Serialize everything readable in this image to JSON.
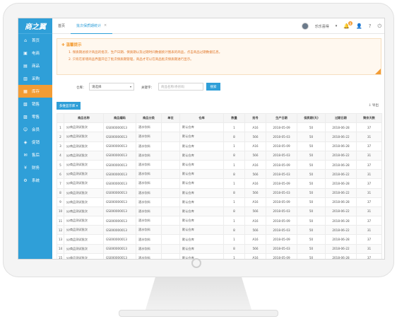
{
  "app": {
    "logo_text": "商之翼"
  },
  "sidebar": {
    "items": [
      {
        "label": "首页",
        "icon": "home-icon",
        "glyph": "⌂",
        "active": false
      },
      {
        "label": "电商",
        "icon": "cart-icon",
        "glyph": "▣",
        "active": false
      },
      {
        "label": "商品",
        "icon": "box-icon",
        "glyph": "▤",
        "active": false
      },
      {
        "label": "采购",
        "icon": "truck-icon",
        "glyph": "▥",
        "active": false
      },
      {
        "label": "库存",
        "icon": "warehouse-icon",
        "glyph": "▦",
        "active": true
      },
      {
        "label": "销售",
        "icon": "sales-icon",
        "glyph": "▧",
        "active": false
      },
      {
        "label": "零售",
        "icon": "retail-icon",
        "glyph": "▨",
        "active": false
      },
      {
        "label": "会员",
        "icon": "member-icon",
        "glyph": "☺",
        "active": false
      },
      {
        "label": "促销",
        "icon": "promo-icon",
        "glyph": "◈",
        "active": false
      },
      {
        "label": "售后",
        "icon": "service-icon",
        "glyph": "✉",
        "active": false
      },
      {
        "label": "财务",
        "icon": "finance-icon",
        "glyph": "¥",
        "active": false
      },
      {
        "label": "系统",
        "icon": "gear-icon",
        "glyph": "⚙",
        "active": false
      }
    ]
  },
  "topbar": {
    "tabs": [
      {
        "label": "首页",
        "active": false
      },
      {
        "label": "批次保质期统计",
        "active": true,
        "close": "×"
      }
    ],
    "user_name": "乐乐喜得",
    "user_caret": "▾",
    "bell_badge": "8",
    "icons": {
      "bell": "🔔",
      "user": "👤",
      "help": "?",
      "exit": "⏻",
      "search": "🔍"
    }
  },
  "notice": {
    "title": "温馨提示",
    "lines": [
      "1. 保质期总统计商品的批次、生产日期、保质期以及过期时间数据统计图表的商品，点击商品过期数据信息。",
      "2. 只有在新增商品界面开启了批次保质期管理，商品才可以在商品批次保质期进行显示。"
    ]
  },
  "filter": {
    "warehouse_label": "仓库：",
    "warehouse_value": "请选择",
    "keyword_label": "关键字：",
    "keyword_placeholder": "商品名称/条形码",
    "search_button": "搜索"
  },
  "toolbar": {
    "multi_button": "多维显示库 ▾",
    "export_label": "导出"
  },
  "table": {
    "columns": [
      "",
      "商品名称",
      "商品编码",
      "商品分类",
      "单位",
      "仓库",
      "数量",
      "批号",
      "生产日期",
      "保质期(天)",
      "过期日期",
      "剩余天数"
    ],
    "rows": [
      [
        "1",
        "yy商品测试批次",
        "GS000000013",
        "酒水饮料",
        "",
        "默认仓库",
        "1",
        "A16",
        "2018-05-09",
        "50",
        "2018-06-28",
        "37"
      ],
      [
        "2",
        "yy商品测试批次",
        "GS000000013",
        "酒水饮料",
        "",
        "默认仓库",
        "8",
        "566",
        "2018-05-03",
        "50",
        "2018-06-22",
        "31"
      ],
      [
        "3",
        "yy商品测试批次",
        "GS000000013",
        "酒水饮料",
        "",
        "默认仓库",
        "1",
        "A16",
        "2018-05-09",
        "50",
        "2018-06-28",
        "37"
      ],
      [
        "4",
        "yy商品测试批次",
        "GS000000013",
        "酒水饮料",
        "",
        "默认仓库",
        "8",
        "566",
        "2018-05-03",
        "50",
        "2018-06-22",
        "31"
      ],
      [
        "5",
        "yy商品测试批次",
        "GS000000013",
        "酒水饮料",
        "",
        "默认仓库",
        "1",
        "A16",
        "2018-05-09",
        "50",
        "2018-06-28",
        "37"
      ],
      [
        "6",
        "yy商品测试批次",
        "GS000000013",
        "酒水饮料",
        "",
        "默认仓库",
        "8",
        "566",
        "2018-05-03",
        "50",
        "2018-06-22",
        "31"
      ],
      [
        "7",
        "yy商品测试批次",
        "GS000000013",
        "酒水饮料",
        "",
        "默认仓库",
        "1",
        "A16",
        "2018-05-09",
        "50",
        "2018-06-28",
        "37"
      ],
      [
        "8",
        "yy商品测试批次",
        "GS000000013",
        "酒水饮料",
        "",
        "默认仓库",
        "8",
        "566",
        "2018-05-03",
        "50",
        "2018-06-22",
        "31"
      ],
      [
        "9",
        "yy商品测试批次",
        "GS000000013",
        "酒水饮料",
        "",
        "默认仓库",
        "1",
        "A16",
        "2018-05-09",
        "50",
        "2018-06-28",
        "37"
      ],
      [
        "10",
        "yy商品测试批次",
        "GS000000013",
        "酒水饮料",
        "",
        "默认仓库",
        "8",
        "566",
        "2018-05-03",
        "50",
        "2018-06-22",
        "31"
      ],
      [
        "11",
        "yy商品测试批次",
        "GS000000013",
        "酒水饮料",
        "",
        "默认仓库",
        "1",
        "A16",
        "2018-05-09",
        "50",
        "2018-06-28",
        "37"
      ],
      [
        "12",
        "yy商品测试批次",
        "GS000000013",
        "酒水饮料",
        "",
        "默认仓库",
        "8",
        "566",
        "2018-05-03",
        "50",
        "2018-06-22",
        "31"
      ],
      [
        "13",
        "yy商品测试批次",
        "GS000000013",
        "酒水饮料",
        "",
        "默认仓库",
        "1",
        "A16",
        "2018-05-09",
        "50",
        "2018-06-28",
        "37"
      ],
      [
        "14",
        "yy商品测试批次",
        "GS000000013",
        "酒水饮料",
        "",
        "默认仓库",
        "8",
        "566",
        "2018-05-03",
        "50",
        "2018-06-22",
        "31"
      ],
      [
        "15",
        "yy商品测试批次",
        "GS000000013",
        "酒水饮料",
        "",
        "默认仓库",
        "1",
        "A16",
        "2018-05-09",
        "50",
        "2018-06-28",
        "37"
      ],
      [
        "16",
        "yy商品测试批次",
        "GS000000013",
        "酒水饮料",
        "",
        "默认仓库",
        "8",
        "566",
        "2018-05-03",
        "50",
        "2018-06-22",
        "31"
      ]
    ]
  },
  "colors": {
    "brand": "#2f9fd8",
    "accent": "#f39c34",
    "notice_text": "#e0772a"
  }
}
